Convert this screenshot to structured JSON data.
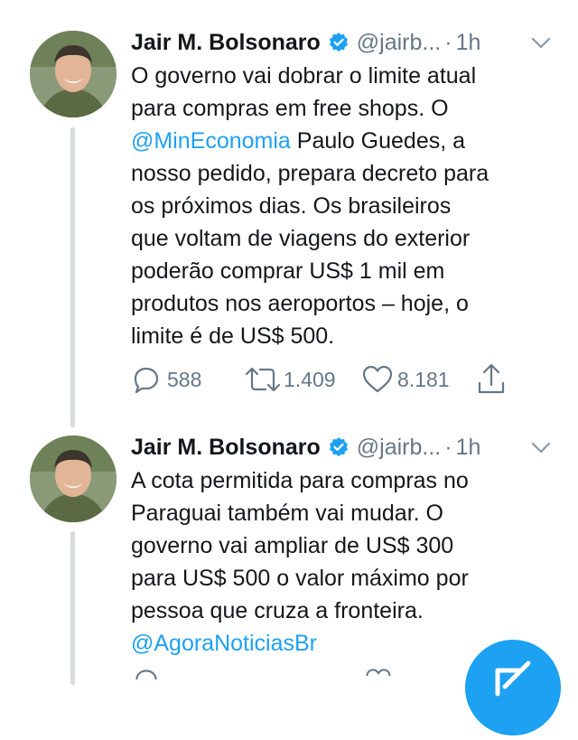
{
  "tweets": [
    {
      "name": "Jair M. Bolsonaro",
      "handle": "@jairb...",
      "dot": "·",
      "time": "1h",
      "lines": [
        {
          "pre": "O governo vai dobrar o limite atual",
          "mention": "",
          "post": ""
        },
        {
          "pre": "para compras em free shops. O",
          "mention": "",
          "post": ""
        },
        {
          "pre": "",
          "mention": "@MinEconomia",
          "post": " Paulo Guedes, a"
        },
        {
          "pre": "nosso pedido, prepara decreto para",
          "mention": "",
          "post": ""
        },
        {
          "pre": "os próximos dias. Os brasileiros",
          "mention": "",
          "post": ""
        },
        {
          "pre": "que voltam de viagens do exterior",
          "mention": "",
          "post": ""
        },
        {
          "pre": "poderão comprar US$ 1 mil em",
          "mention": "",
          "post": ""
        },
        {
          "pre": "produtos nos aeroportos – hoje, o",
          "mention": "",
          "post": ""
        },
        {
          "pre": "limite é de US$ 500.",
          "mention": "",
          "post": ""
        }
      ],
      "replies": "588",
      "retweets": "1.409",
      "likes": "8.181"
    },
    {
      "name": "Jair M. Bolsonaro",
      "handle": "@jairb...",
      "dot": "·",
      "time": "1h",
      "lines": [
        {
          "pre": "A cota permitida para compras no",
          "mention": "",
          "post": ""
        },
        {
          "pre": "Paraguai também vai mudar. O",
          "mention": "",
          "post": ""
        },
        {
          "pre": "governo vai ampliar de US$ 300",
          "mention": "",
          "post": ""
        },
        {
          "pre": "para US$ 500 o valor máximo por",
          "mention": "",
          "post": ""
        },
        {
          "pre": "pessoa que cruza a fronteira.",
          "mention": "",
          "post": ""
        },
        {
          "pre": "",
          "mention": "@AgoraNoticiasBr",
          "post": ""
        }
      ]
    }
  ],
  "icons": {
    "verified": "verified-badge-icon",
    "chevron": "chevron-down-icon",
    "reply": "reply-icon",
    "retweet": "retweet-icon",
    "like": "heart-icon",
    "share": "share-icon",
    "compose": "compose-tweet-icon"
  },
  "colors": {
    "accent": "#1da1f2",
    "text": "#14171a",
    "muted": "#657786",
    "thread_line": "#d6dce0"
  }
}
